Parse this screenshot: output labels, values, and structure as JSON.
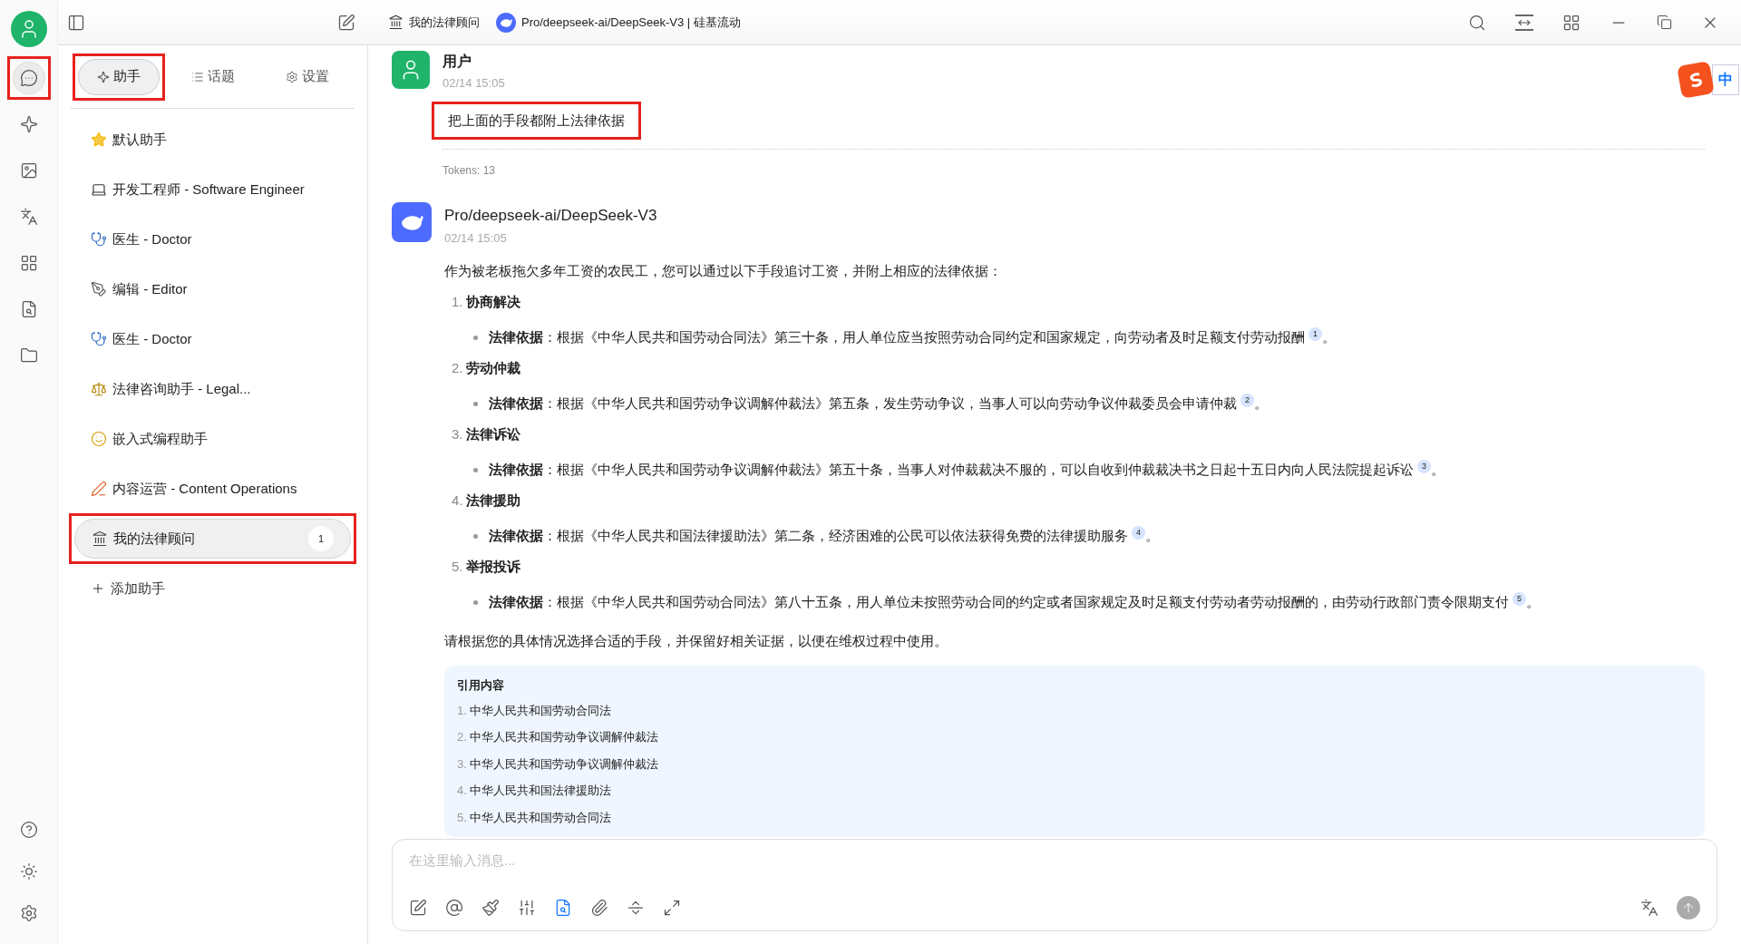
{
  "title_bar": {
    "assistant": "我的法律顾问",
    "model": "Pro/deepseek-ai/DeepSeek-V3 | 硅基流动"
  },
  "rail": {
    "items": [
      {
        "selected": true,
        "highlighted": true
      },
      {
        "selected": false,
        "highlighted": false
      },
      {
        "selected": false,
        "highlighted": false
      },
      {
        "selected": false,
        "highlighted": false
      },
      {
        "selected": false,
        "highlighted": false
      },
      {
        "selected": false,
        "highlighted": false
      },
      {
        "selected": false,
        "highlighted": false
      }
    ]
  },
  "tabs": [
    {
      "label": "助手",
      "selected": true,
      "highlighted": true
    },
    {
      "label": "话题",
      "selected": false,
      "highlighted": false
    },
    {
      "label": "设置",
      "selected": false,
      "highlighted": false
    }
  ],
  "assistants": [
    {
      "name": "默认助手",
      "selected": false,
      "highlighted": false
    },
    {
      "name": "开发工程师 - Software Engineer",
      "selected": false,
      "highlighted": false
    },
    {
      "name": "医生 - Doctor",
      "selected": false,
      "highlighted": false
    },
    {
      "name": "编辑 - Editor",
      "selected": false,
      "highlighted": false
    },
    {
      "name": "医生 - Doctor",
      "selected": false,
      "highlighted": false
    },
    {
      "name": "法律咨询助手 - Legal...",
      "selected": false,
      "highlighted": false
    },
    {
      "name": "嵌入式编程助手",
      "selected": false,
      "highlighted": false
    },
    {
      "name": "内容运营 - Content Operations",
      "selected": false,
      "highlighted": false
    },
    {
      "name": "我的法律顾问",
      "selected": true,
      "highlighted": true,
      "count": "1"
    }
  ],
  "add_assistant": "添加助手",
  "user_message": {
    "author": "用户",
    "time": "02/14 15:05",
    "text": "把上面的手段都附上法律依据",
    "highlighted": true,
    "tokens": "Tokens: 13"
  },
  "reply": {
    "author": "Pro/deepseek-ai/DeepSeek-V3",
    "time": "02/14 15:05",
    "intro": "作为被老板拖欠多年工资的农民工，您可以通过以下手段追讨工资，并附上相应的法律依据：",
    "steps": [
      {
        "number": "1.",
        "title": "协商解决",
        "basis": "**法律依据**：根据《中华人民共和国劳动合同法》第三十条，用人单位应当按照劳动合同约定和国家规定，向劳动者及时足额支付劳动报酬",
        "ref": "1",
        "end": "。"
      },
      {
        "number": "2.",
        "title": "劳动仲裁",
        "basis": "**法律依据**：根据《中华人民共和国劳动争议调解仲裁法》第五条，发生劳动争议，当事人可以向劳动争议仲裁委员会申请仲裁",
        "ref": "2",
        "end": "。"
      },
      {
        "number": "3.",
        "title": "法律诉讼",
        "basis": "**法律依据**：根据《中华人民共和国劳动争议调解仲裁法》第五十条，当事人对仲裁裁决不服的，可以自收到仲裁裁决书之日起十五日内向人民法院提起诉讼",
        "ref": "3",
        "end": "。"
      },
      {
        "number": "4.",
        "title": "法律援助",
        "basis": "**法律依据**：根据《中华人民共和国法律援助法》第二条，经济困难的公民可以依法获得免费的法律援助服务",
        "ref": "4",
        "end": "。"
      },
      {
        "number": "5.",
        "title": "举报投诉",
        "basis": "**法律依据**：根据《中华人民共和国劳动合同法》第八十五条，用人单位未按照劳动合同的约定或者国家规定及时足额支付劳动者劳动报酬的，由劳动行政部门责令限期支付",
        "ref": "5",
        "end": "。"
      }
    ],
    "closing": "请根据您的具体情况选择合适的手段，并保留好相关证据，以便在维权过程中使用。",
    "citations": {
      "title": "引用内容",
      "items": [
        {
          "number": "1.",
          "text": "中华人民共和国劳动合同法"
        },
        {
          "number": "2.",
          "text": "中华人民共和国劳动争议调解仲裁法"
        },
        {
          "number": "3.",
          "text": "中华人民共和国劳动争议调解仲裁法"
        },
        {
          "number": "4.",
          "text": "中华人民共和国法律援助法"
        },
        {
          "number": "5.",
          "text": "中华人民共和国劳动合同法"
        }
      ]
    }
  },
  "composer": {
    "placeholder": "在这里输入消息...",
    "tools": [
      {
        "active": false
      },
      {
        "active": false
      },
      {
        "active": false
      },
      {
        "active": false
      },
      {
        "active": true
      },
      {
        "active": false
      },
      {
        "active": false
      },
      {
        "active": false
      }
    ]
  },
  "ime_badge": "中"
}
